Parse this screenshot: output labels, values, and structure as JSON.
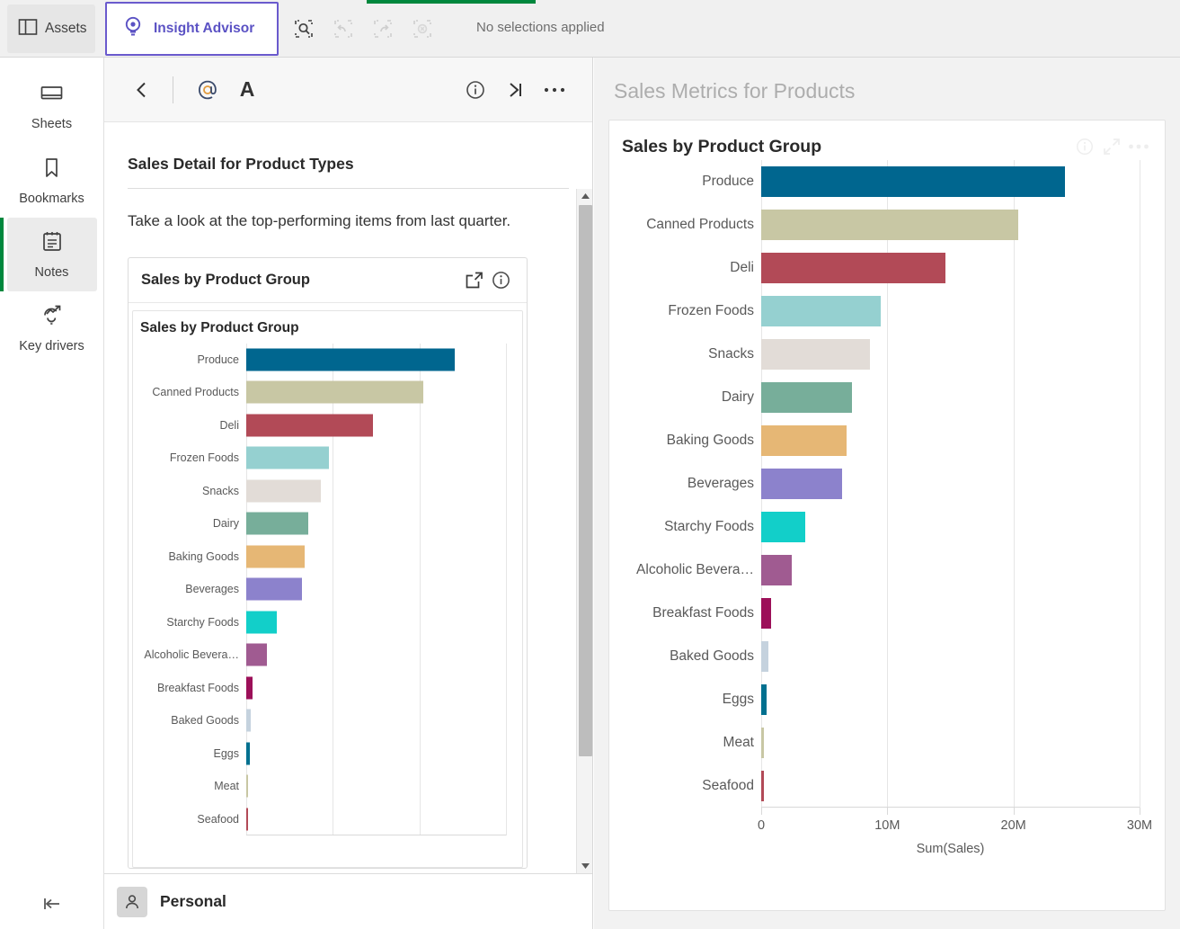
{
  "topbar": {
    "assets_label": "Assets",
    "insight_advisor_label": "Insight Advisor",
    "no_selections_label": "No selections applied",
    "accent_green": "#00873d",
    "accent_purple": "#5b52c4"
  },
  "rail": {
    "items": [
      {
        "label": "Sheets",
        "icon": "sheet-icon",
        "active": false
      },
      {
        "label": "Bookmarks",
        "icon": "bookmark-icon",
        "active": false
      },
      {
        "label": "Notes",
        "icon": "notes-icon",
        "active": true
      },
      {
        "label": "Key drivers",
        "icon": "key-drivers-icon",
        "active": false
      }
    ]
  },
  "notes": {
    "toolbar": {
      "back": "back-chevron-icon",
      "mention": "@",
      "text_format": "A",
      "info": "info-icon",
      "collapse": "collapse-right-icon",
      "more": "more-options-icon"
    },
    "title": "Sales Detail for Product Types",
    "body_text": "Take a look at the top-performing items from last quarter.",
    "embedded_card": {
      "title": "Sales by Product Group",
      "share_icon": "share-icon",
      "info_icon": "info-icon",
      "chart_title": "Sales by Product Group"
    },
    "footer": {
      "user": "Personal",
      "avatar_icon": "user-avatar-icon"
    }
  },
  "right_panel": {
    "title": "Sales Metrics for Products",
    "card": {
      "title": "Sales by Product Group",
      "icons": [
        "info-icon",
        "fullscreen-icon",
        "more-options-icon"
      ]
    }
  },
  "chart_data": {
    "type": "bar",
    "orientation": "horizontal",
    "title": "Sales by Product Group",
    "xlabel": "Sum(Sales)",
    "ylabel": "",
    "xlim": [
      0,
      30000000
    ],
    "xticks": [
      0,
      10000000,
      20000000,
      30000000
    ],
    "xtick_labels": [
      "0",
      "10M",
      "20M",
      "30M"
    ],
    "grid": true,
    "legend": "none",
    "categories": [
      "Produce",
      "Canned Products",
      "Deli",
      "Frozen Foods",
      "Snacks",
      "Dairy",
      "Baking Goods",
      "Beverages",
      "Starchy Foods",
      "Alcoholic Bevera…",
      "Breakfast Foods",
      "Baked Goods",
      "Eggs",
      "Meat",
      "Seafood"
    ],
    "values": [
      24100000,
      20400000,
      14600000,
      9500000,
      8600000,
      7200000,
      6750000,
      6400000,
      3500000,
      2400000,
      760000,
      550000,
      420000,
      140000,
      120000
    ],
    "colors": [
      "#00668f",
      "#c8c7a4",
      "#b24a57",
      "#95d0d0",
      "#e2dcd7",
      "#77ae9a",
      "#e6b775",
      "#8c82cc",
      "#12cfc9",
      "#a05b91",
      "#9c1059",
      "#c5d2de",
      "#00708f",
      "#c8c7a4",
      "#b24a57"
    ]
  }
}
